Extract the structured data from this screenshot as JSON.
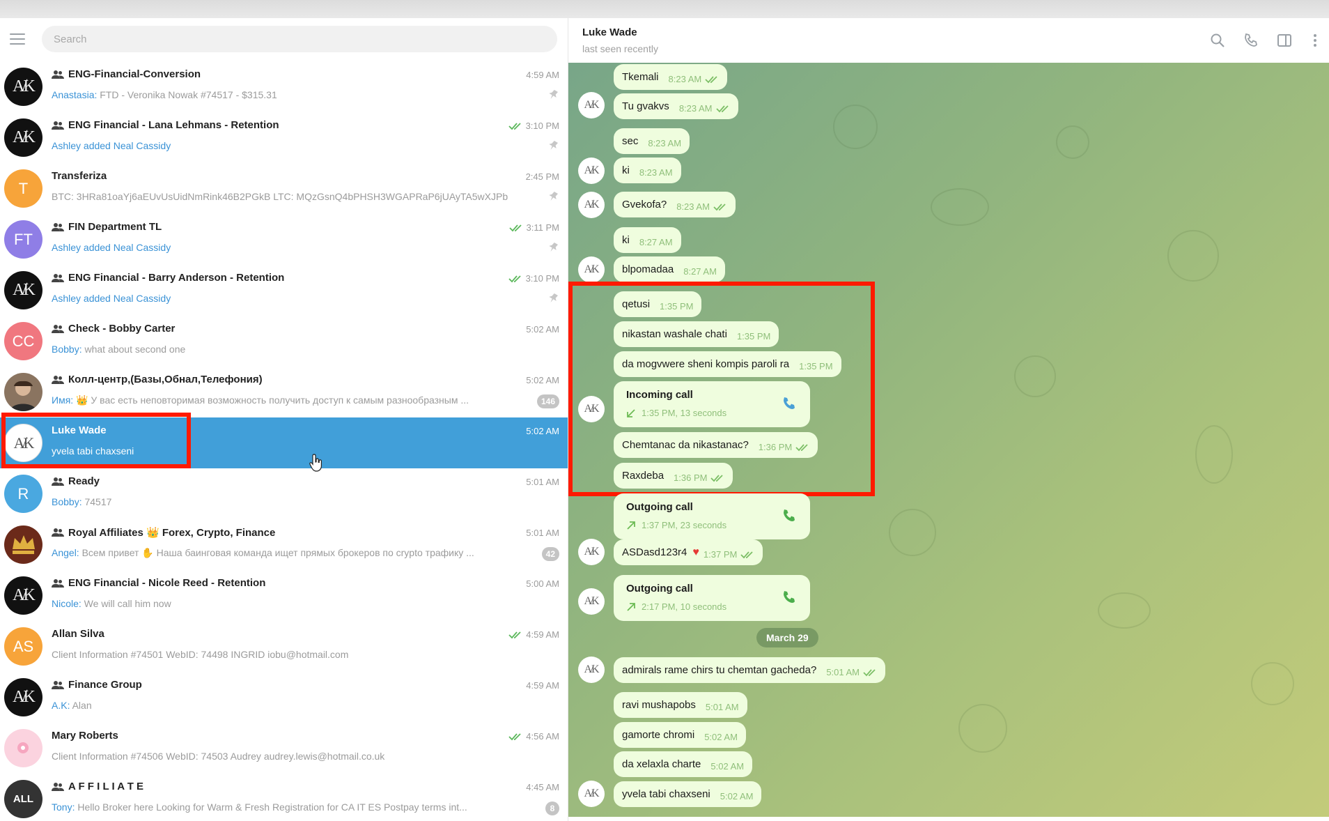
{
  "search": {
    "placeholder": "Search"
  },
  "chats": [
    {
      "title": "ENG-Financial-Conversion",
      "group": true,
      "time": "4:59 AM",
      "sender": "Anastasia:",
      "preview": " FTD - Veronika Nowak #74517 - $315.31",
      "pinned": true,
      "avatar": "AK"
    },
    {
      "title": "ENG Financial - Lana Lehmans - Retention",
      "group": true,
      "time": "3:10 PM",
      "read": true,
      "sender": "Ashley added Neal Cassidy",
      "preview": "",
      "pinned": true,
      "avatar": "AK"
    },
    {
      "title": "Transferiza",
      "group": false,
      "time": "2:45 PM",
      "sender": "",
      "preview": "BTC: 3HRa81oaYj6aEUvUsUidNmRink46B2PGkB  LTC: MQzGsnQ4bPHSH3WGAPRaP6jUAyTA5wXJPb",
      "pinned": true,
      "avatar": "T",
      "avatar_color": "#f7a43a"
    },
    {
      "title": "FIN Department TL",
      "group": true,
      "time": "3:11 PM",
      "read": true,
      "sender": "Ashley added Neal Cassidy",
      "preview": "",
      "pinned": true,
      "avatar": "FT",
      "avatar_color": "#8f7ee6"
    },
    {
      "title": "ENG Financial - Barry Anderson - Retention",
      "group": true,
      "time": "3:10 PM",
      "read": true,
      "sender": "Ashley added Neal Cassidy",
      "preview": "",
      "pinned": true,
      "avatar": "AK"
    },
    {
      "title": "Check - Bobby Carter",
      "group": true,
      "time": "5:02 AM",
      "sender": "Bobby:",
      "preview": " what about second one",
      "avatar": "CC",
      "avatar_color": "#f0777f"
    },
    {
      "title": "Колл-центр,(Базы,Обнал,Телефония)",
      "group": true,
      "time": "5:02 AM",
      "sender": "Имя:",
      "preview": " 👑 У вас есть неповторимая возможность получить доступ к самым разнообразным ...",
      "badge": "146",
      "avatar": "photo"
    },
    {
      "title": "Luke Wade",
      "group": false,
      "time": "5:02 AM",
      "sender": "",
      "preview": "yvela tabi chaxseni",
      "active": true,
      "avatar": "AK-light"
    },
    {
      "title": "Ready",
      "group": true,
      "time": "5:01 AM",
      "sender": "Bobby:",
      "preview": " 74517",
      "avatar": "R",
      "avatar_color": "#4aa8e0"
    },
    {
      "title": "Royal Affiliates 👑 Forex, Crypto, Finance",
      "group": true,
      "time": "5:01 AM",
      "sender": "Angel:",
      "preview": " Всем привет ✋ Наша баинговая команда ищет прямых брокеров по crypto трафику ...",
      "badge": "42",
      "avatar": "royal"
    },
    {
      "title": "ENG Financial - Nicole Reed - Retention",
      "group": true,
      "time": "5:00 AM",
      "sender": "Nicole:",
      "preview": " We will call him now",
      "avatar": "AK"
    },
    {
      "title": "Allan Silva",
      "group": false,
      "time": "4:59 AM",
      "read": true,
      "sender": "",
      "preview": "Client Information #74501 WebID: 74498 INGRID iobu@hotmail.com",
      "avatar": "AS",
      "avatar_color": "#f7a43a"
    },
    {
      "title": "Finance Group",
      "group": true,
      "time": "4:59 AM",
      "sender": "A.K:",
      "preview": " Alan",
      "avatar": "AK"
    },
    {
      "title": "Mary Roberts",
      "group": false,
      "time": "4:56 AM",
      "read": true,
      "sender": "",
      "preview": "Client Information #74506 WebID: 74503 Audrey audrey.lewis@hotmail.co.uk",
      "avatar": "pink"
    },
    {
      "title": "A F F I L I A T E",
      "group": true,
      "time": "4:45 AM",
      "sender": "Tony:",
      "preview": " Hello Broker here    Looking for Warm & Fresh Registration for CA IT ES    Postpay terms int...",
      "badge": "8",
      "avatar": "ALL"
    }
  ],
  "header": {
    "name": "Luke Wade",
    "status": "last seen recently"
  },
  "messages": [
    {
      "type": "text",
      "text": "Tkemali",
      "time": "8:23 AM",
      "read": true
    },
    {
      "type": "text",
      "text": "Tu gvakvs",
      "time": "8:23 AM",
      "read": true
    },
    {
      "type": "text",
      "text": "sec",
      "time": "8:23 AM"
    },
    {
      "type": "text",
      "text": "ki",
      "time": "8:23 AM"
    },
    {
      "type": "text",
      "text": "Gvekofa?",
      "time": "8:23 AM",
      "read": true
    },
    {
      "type": "text",
      "text": "ki",
      "time": "8:27 AM"
    },
    {
      "type": "text",
      "text": "blpomadaa",
      "time": "8:27 AM"
    },
    {
      "type": "text",
      "text": "qetusi",
      "time": "1:35 PM"
    },
    {
      "type": "text",
      "text": "nikastan washale chati",
      "time": "1:35 PM"
    },
    {
      "type": "text",
      "text": "da mogvwere sheni kompis paroli ra",
      "time": "1:35 PM"
    },
    {
      "type": "call",
      "title": "Incoming call",
      "meta": "1:35 PM, 13 seconds"
    },
    {
      "type": "text",
      "text": "Chemtanac da nikastanac?",
      "time": "1:36 PM",
      "read": true
    },
    {
      "type": "text",
      "text": "Raxdeba",
      "time": "1:36 PM",
      "read": true
    },
    {
      "type": "call",
      "title": "Outgoing call",
      "meta": "1:37 PM, 23 seconds"
    },
    {
      "type": "text",
      "text": "ASDasd123r4",
      "time": "1:37 PM",
      "read": true,
      "heart": true
    },
    {
      "type": "call",
      "title": "Outgoing call",
      "meta": "2:17 PM, 10 seconds"
    },
    {
      "type": "date",
      "text": "March 29"
    },
    {
      "type": "text",
      "text": "admirals rame chirs tu chemtan gacheda?",
      "time": "5:01 AM",
      "read": true
    },
    {
      "type": "text",
      "text": "ravi mushapobs",
      "time": "5:01 AM"
    },
    {
      "type": "text",
      "text": "gamorte chromi",
      "time": "5:02 AM"
    },
    {
      "type": "text",
      "text": "da xelaxla charte",
      "time": "5:02 AM"
    },
    {
      "type": "text",
      "text": "yvela tabi chaxseni",
      "time": "5:02 AM"
    }
  ],
  "colors": {
    "accent": "#419fd9",
    "bubble": "#effdde",
    "highlight": "#ff1a00"
  }
}
